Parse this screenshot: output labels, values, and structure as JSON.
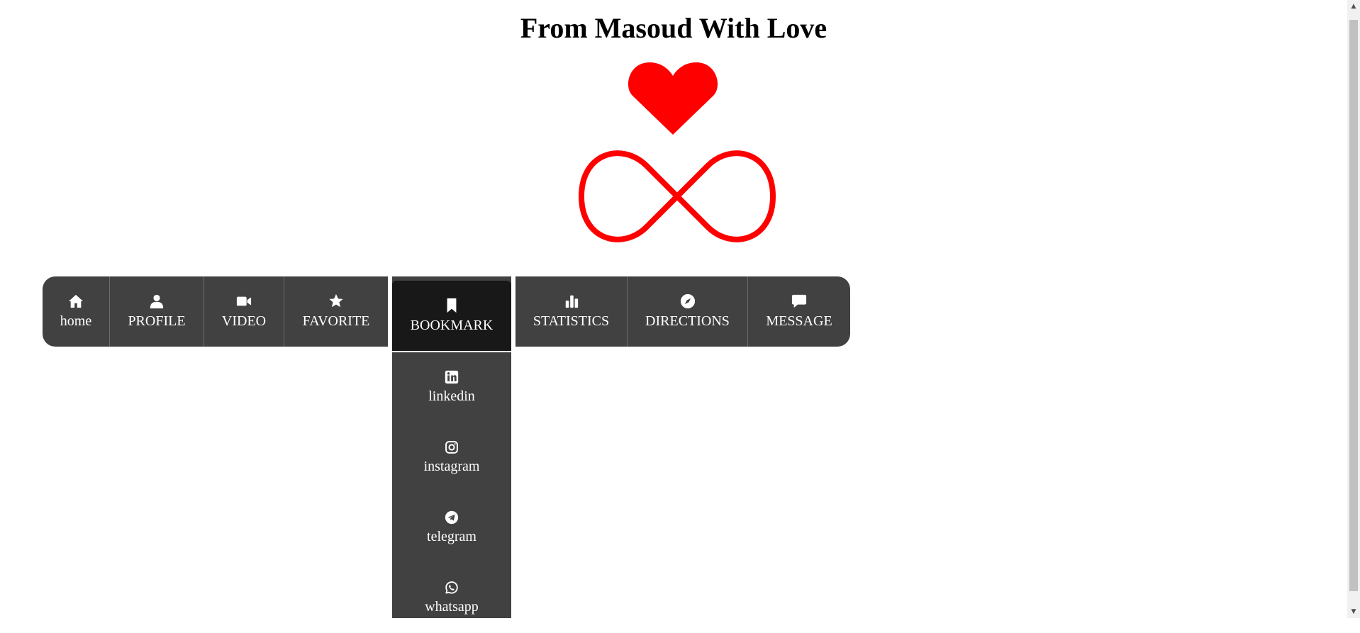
{
  "title": "From Masoud With Love",
  "colors": {
    "accent": "#ff0000",
    "nav_bg": "#414141",
    "nav_active_bg": "#181818"
  },
  "nav": {
    "items": [
      {
        "label": "home",
        "icon": "home-icon"
      },
      {
        "label": "PROFILE",
        "icon": "user-icon"
      },
      {
        "label": "VIDEO",
        "icon": "video-icon"
      },
      {
        "label": "FAVORITE",
        "icon": "star-icon"
      },
      {
        "label": "BOOKMARK",
        "icon": "bookmark-icon",
        "active": true
      },
      {
        "label": "STATISTICS",
        "icon": "chart-icon"
      },
      {
        "label": "DIRECTIONS",
        "icon": "compass-icon"
      },
      {
        "label": "MESSAGE",
        "icon": "message-icon"
      }
    ]
  },
  "dropdown": {
    "items": [
      {
        "label": "linkedin",
        "icon": "linkedin-icon"
      },
      {
        "label": "instagram",
        "icon": "instagram-icon"
      },
      {
        "label": "telegram",
        "icon": "telegram-icon"
      },
      {
        "label": "whatsapp",
        "icon": "whatsapp-icon"
      }
    ]
  }
}
